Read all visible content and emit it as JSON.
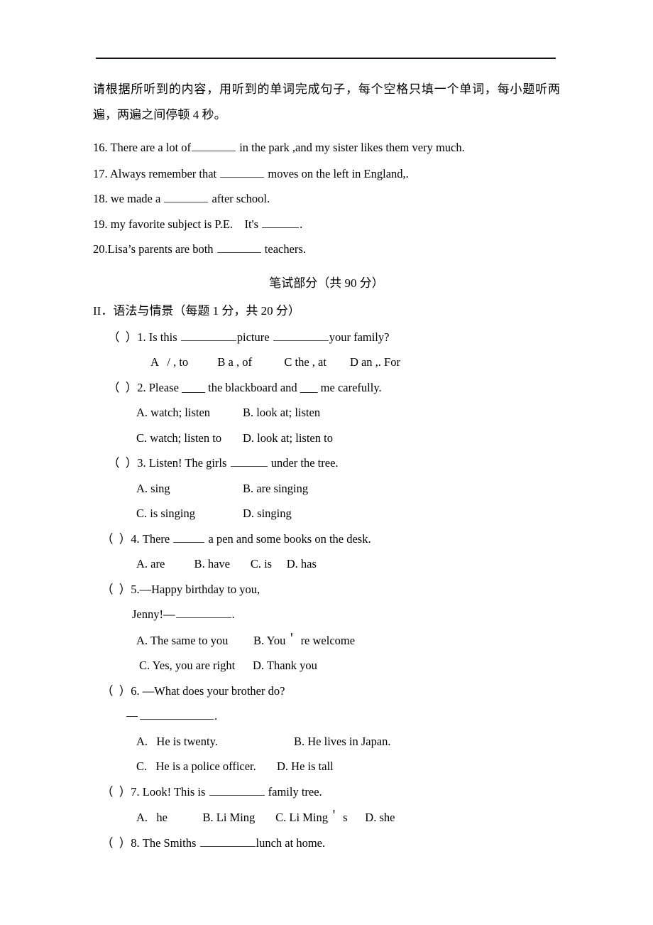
{
  "document": {
    "type": "exam-paper",
    "language": "zh-CN + en"
  },
  "listening_section": {
    "instruction": "请根据所听到的内容，用听到的单词完成句子，每个空格只填一个单词，每小题听两遍，两遍之间停顿 4 秒。",
    "items": [
      {
        "number": "16.",
        "before": "There are a lot of",
        "after": "in the park ,and my sister likes them very much."
      },
      {
        "number": "17.",
        "before": "Always remember that",
        "after": "moves on the left in England,."
      },
      {
        "number": "18.",
        "before": "we made a",
        "after": "after school."
      },
      {
        "number": "19.",
        "before": "my favorite subject is P.E.    It's",
        "after": "."
      },
      {
        "number": "20.",
        "before": "Lisa’s parents are both",
        "after": "teachers."
      }
    ]
  },
  "written_section": {
    "banner": "笔试部分（共 90 分）",
    "heading": "II．语法与情景（每题 1 分，共 20 分）",
    "questions": [
      {
        "marker": "（  ）1.",
        "stem_part1": "Is this",
        "stem_part2": "picture",
        "stem_part3": "your family?",
        "options_line": "A   / , to          B a , of           C the , at        D an ,. For"
      },
      {
        "marker": "（  ）2.",
        "stem": "Please ____ the blackboard and ___ me carefully.",
        "option_a": "A. watch; listen",
        "option_b": "B. look at; listen",
        "option_c": "C. watch; listen to",
        "option_d": "D. look at; listen to"
      },
      {
        "marker": "（  ）3.",
        "stem_before": "Listen! The girls",
        "stem_after": "under the tree.",
        "option_a": "A. sing",
        "option_b": "B. are singing",
        "option_c": "C. is singing",
        "option_d": "D. singing"
      },
      {
        "marker": "（  ）4.",
        "stem_before": "There",
        "stem_after": "a pen and some books on the desk.",
        "options_line": "A. are          B. have       C. is     D. has"
      },
      {
        "marker": "（  ）5.",
        "stem": "—Happy birthday to you,",
        "continuation_before": "Jenny!—",
        "continuation_after": ".",
        "option_a": "A. The same to you",
        "option_b_pre": "B. You",
        "option_b_post": "re welcome",
        "option_c": "C. Yes, you are right",
        "option_d": "D. Thank you"
      },
      {
        "marker": "（  ）6.",
        "stem": "—What does your brother do?",
        "continuation_after": ".",
        "option_a": "A.   He is twenty.",
        "option_b": "B. He lives in Japan.",
        "option_c": "C.   He is a police officer.",
        "option_d": "D. He is tall"
      },
      {
        "marker": "（  ）7.",
        "stem_before": "Look! This is",
        "stem_after": "family tree.",
        "options_pre": "A.   he            B. Li Ming       C. Li Ming",
        "options_post": "s      D. she"
      },
      {
        "marker": "（  ）8.",
        "stem_before": "The Smiths",
        "stem_after": "lunch at home."
      }
    ]
  },
  "glyphs": {
    "apostrophe_raised": "＇"
  }
}
